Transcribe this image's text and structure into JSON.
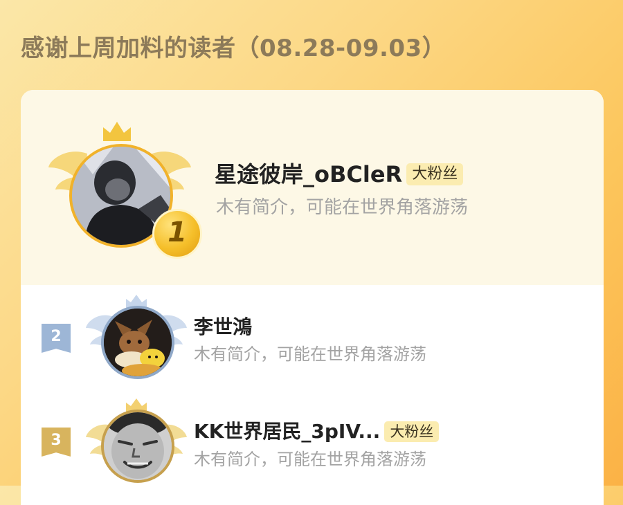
{
  "header": {
    "title": "感谢上周加料的读者（08.28-09.03）"
  },
  "colors": {
    "gold": "#f1b22a",
    "silver": "#9db6d6",
    "bronze": "#d8b45e",
    "badge_bg": "#fbecb0",
    "top_row_bg": "#fdf8e6"
  },
  "readers": [
    {
      "rank": "1",
      "name": "星途彼岸_oBCleR",
      "badge": "大粉丝",
      "bio": "木有简介，可能在世界角落游荡",
      "avatar_icon": "hooded-person-photo"
    },
    {
      "rank": "2",
      "name": "李世鴻",
      "badge": "",
      "bio": "木有简介，可能在世界角落游荡",
      "avatar_icon": "eevee-and-pikachu"
    },
    {
      "rank": "3",
      "name": "KK世界居民_3pIV...",
      "badge": "大粉丝",
      "bio": "木有简介，可能在世界角落游荡",
      "avatar_icon": "grinning-face-meme"
    }
  ]
}
